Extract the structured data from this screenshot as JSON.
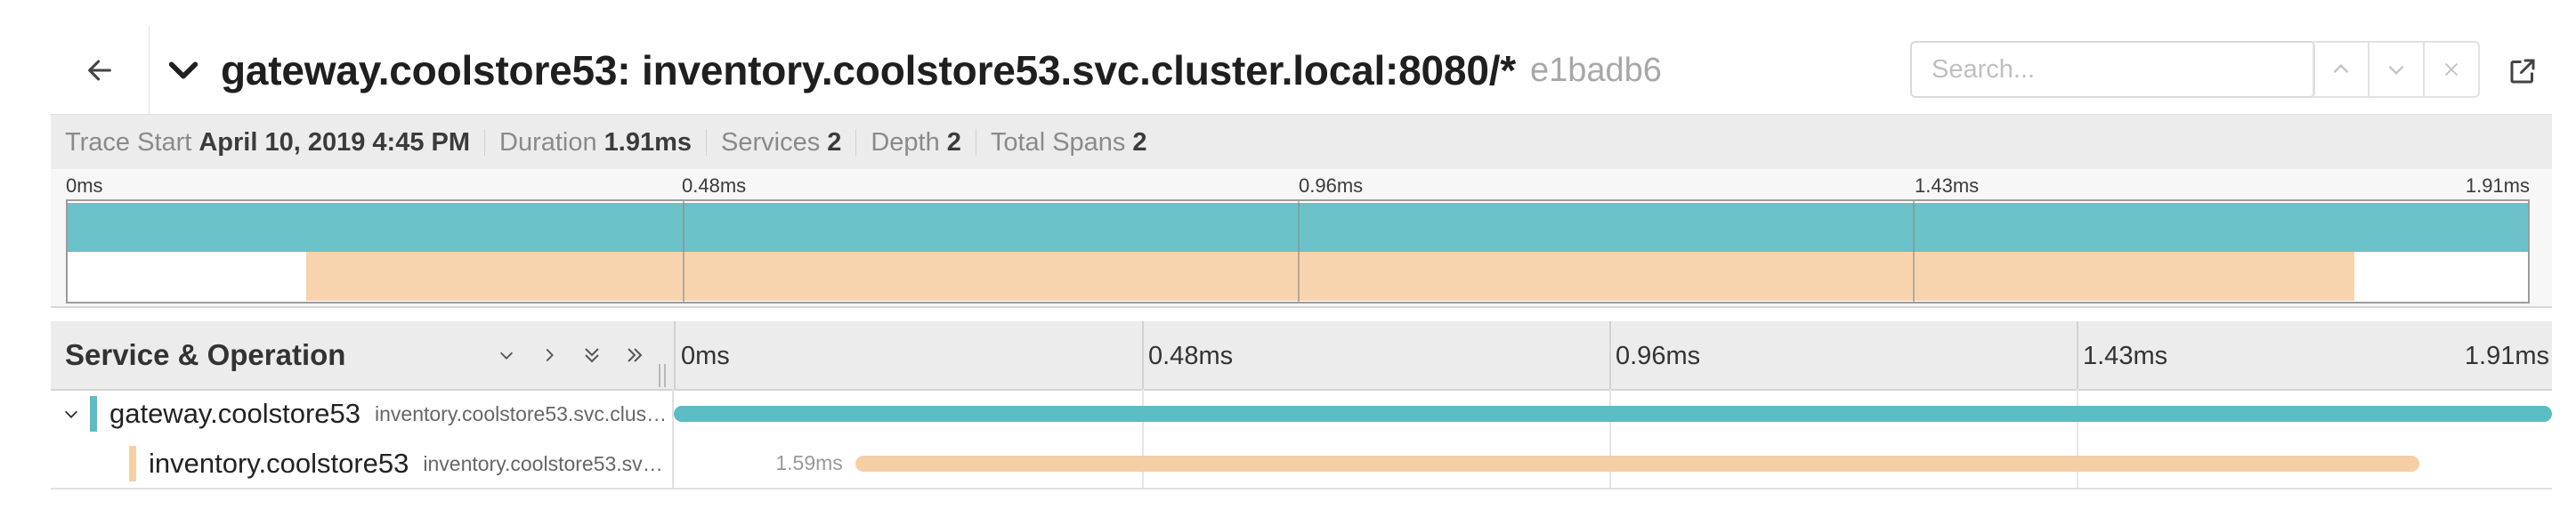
{
  "header": {
    "title": "gateway.coolstore53: inventory.coolstore53.svc.cluster.local:8080/*",
    "trace_id": "e1badb6",
    "search": {
      "placeholder": "Search...",
      "value": ""
    }
  },
  "meta": [
    {
      "label": "Trace Start",
      "value": "April 10, 2019 4:45 PM"
    },
    {
      "label": "Duration",
      "value": "1.91ms"
    },
    {
      "label": "Services",
      "value": "2"
    },
    {
      "label": "Depth",
      "value": "2"
    },
    {
      "label": "Total Spans",
      "value": "2"
    }
  ],
  "minimap": {
    "ticks": [
      "0ms",
      "0.48ms",
      "0.96ms",
      "1.43ms",
      "1.91ms"
    ]
  },
  "timeline": {
    "column_title": "Service & Operation",
    "ticks": [
      "0ms",
      "0.48ms",
      "0.96ms",
      "1.43ms",
      "1.91ms"
    ],
    "total_ms": 1.91
  },
  "spans": [
    {
      "service": "gateway.coolstore53",
      "operation": "inventory.coolstore53.svc.cluster.local:8080/*",
      "operation_display": "inventory.coolstore53.svc.clust…",
      "color": "#5bbcc4",
      "start_ms": 0,
      "duration_ms": 1.91,
      "duration_label": "",
      "depth": 0,
      "has_children": true
    },
    {
      "service": "inventory.coolstore53",
      "operation": "inventory.coolstore53.svc.cluster.local:8080/*",
      "operation_display": "inventory.coolstore53.svc…",
      "color": "#f7cfa5",
      "start_ms": 0.185,
      "duration_ms": 1.59,
      "duration_label": "1.59ms",
      "depth": 1,
      "has_children": false
    }
  ],
  "colors": {
    "gateway": "#5bbcc4",
    "inventory": "#f7cfa5",
    "minimap_gateway": "#6bc2c8",
    "minimap_inventory": "#f7d4ae"
  }
}
